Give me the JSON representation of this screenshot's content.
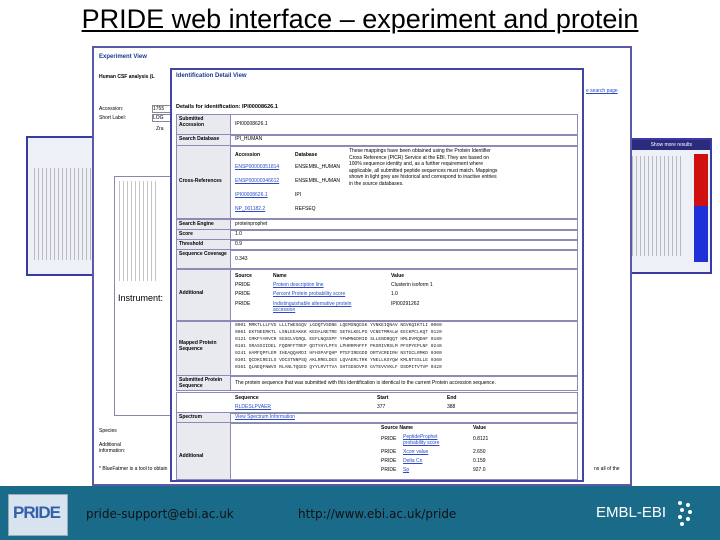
{
  "slide": {
    "title": "PRIDE web interface – experiment and protein"
  },
  "experiment_view": {
    "title": "Experiment View",
    "subtitle": "Human CSF analysis (L",
    "labels": [
      "Accession:",
      "Short Label:"
    ],
    "values": [
      "1755",
      "LOG",
      "Zra"
    ],
    "search_link": "e search page",
    "bottom_labels": [
      "Species",
      "Additional information:",
      "* BlueFatmer is a tool to obtain"
    ],
    "note": "ns all of the"
  },
  "instrument": {
    "label": "Instrument:"
  },
  "ident_view": {
    "title": "Identification Detail View",
    "details_title": "Details for identification: IPI00008626.1",
    "submitted_accession_label": "Submitted Accession",
    "submitted_accession": "IPI00008626.1",
    "search_db_label": "Search Database",
    "search_db": "IPI_HUMAN",
    "xref_label": "Cross-References",
    "xref_col1": "Accession",
    "xref_col2": "Database",
    "xref_rows": [
      [
        "ENSP00000351814",
        "ENSEMBL_HUMAN"
      ],
      [
        "ENSP00000346612",
        "ENSEMBL_HUMAN"
      ],
      [
        "IPI00008626.1",
        "IPI"
      ],
      [
        "NP_001182.2",
        "REFSEQ"
      ]
    ],
    "xref_note": "These mappings have been obtained using the Protein Identifier Cross Reference (PICR) Service at the EBI. They are based on 100% sequence identity and, as a further requirement where applicable, all submitted peptide sequences must match. Mappings shown in light grey are historical and correspond to inactive entries in the source databases.",
    "search_engine_label": "Search Engine",
    "search_engine": "proteinprophet",
    "score_label": "Score",
    "score": "1.0",
    "threshold_label": "Threshold",
    "threshold": "0.9",
    "coverage_label": "Sequence Coverage",
    "coverage": "0.343",
    "additional_label": "Additional",
    "add_cols": [
      "Source",
      "Name",
      "Value"
    ],
    "add_rows": [
      [
        "PRIDE",
        "Protein description line",
        "Clusterin isoform 1"
      ],
      [
        "PRIDE",
        "Percent Protein probability score",
        "1.0"
      ],
      [
        "PRIDE",
        "Indistinguishable alternative protein accession",
        "IPI00291262"
      ]
    ],
    "mapped_label": "Mapped Protein Sequence",
    "sequence_lines": [
      "0001 MMKTLLLFVG LLLTWESGQV LGDQTVSDNE LQEMSNQGSK YVNKEIQNAV NGVKQIKTLI 0060",
      "0061 EKTNEERKTL LSNLEEAKKK KEDALNETRE SETKLKELPG VCNETMMALW EECKPCLKQT 0120",
      "0121 CMKFYARVCR SGSGLVGRQL EEFLNQSSPF YFWMNGDRID SLLENDRQQT HMLDVMQDHF 0180",
      "0181 SRASSIIDEL FQDRFFTREP QDTYHYLPFS LPHRRPHFFF PKSRIVRSLM PFSPYEPLNF 0240",
      "0241 HAMFQPFLEM IHEAQQAMDI HFHSPAFQHP PTEFIREGDD DRTVCREIRH NSTGCLRMKD 0300",
      "0301 QCDKCREILS VDCSTNNPSQ AKLRRELDES LQVAERLTRK YNELLKSYQW KMLNTSSLLE 0360",
      "0361 QLNEQFNWVS RLANLTQGED QYYLRVTTVA SHTSDSDVPS GVTEVVVKLF DSDPITVTVP 0420",
      "0421 VEVSRKNPKF METVAEKALQ EYRKKHREE                             0449"
    ],
    "submitted_seq_label": "Submitted Protein Sequence",
    "submitted_seq_note": "The protein sequence that was submitted with this identification is identical to the current Protein accession sequence.",
    "pep_cols": [
      "Sequence",
      "Start",
      "End"
    ],
    "pep_row": [
      "RLDESLPVAER",
      "377",
      "388"
    ],
    "spectrum_label": "Spectrum",
    "spectrum_link": "View Spectrum Information",
    "add2_label": "Additional",
    "add2_cols": [
      "Source Name",
      "Value"
    ],
    "add2_rows": [
      [
        "PRIDE",
        "PeptideProphet probability score",
        "0.8121"
      ],
      [
        "PRIDE",
        "Xcorr value",
        "2.650"
      ],
      [
        "PRIDE",
        "Delta Cn",
        "0.159"
      ],
      [
        "PRIDE",
        "Sp",
        "927.0"
      ]
    ]
  },
  "right_pane": {
    "bar_text": "Show more results"
  },
  "footer": {
    "logo_text": "PRIDE",
    "email": "pride-support@ebi.ac.uk",
    "url": "http://www.ebi.ac.uk/pride",
    "org": "EMBL-EBI"
  },
  "colors": {
    "footer_bg": "#1a6b8a",
    "window_border": "#4545a5",
    "highlight_red": "#d01010",
    "highlight_blue": "#2030d8"
  }
}
